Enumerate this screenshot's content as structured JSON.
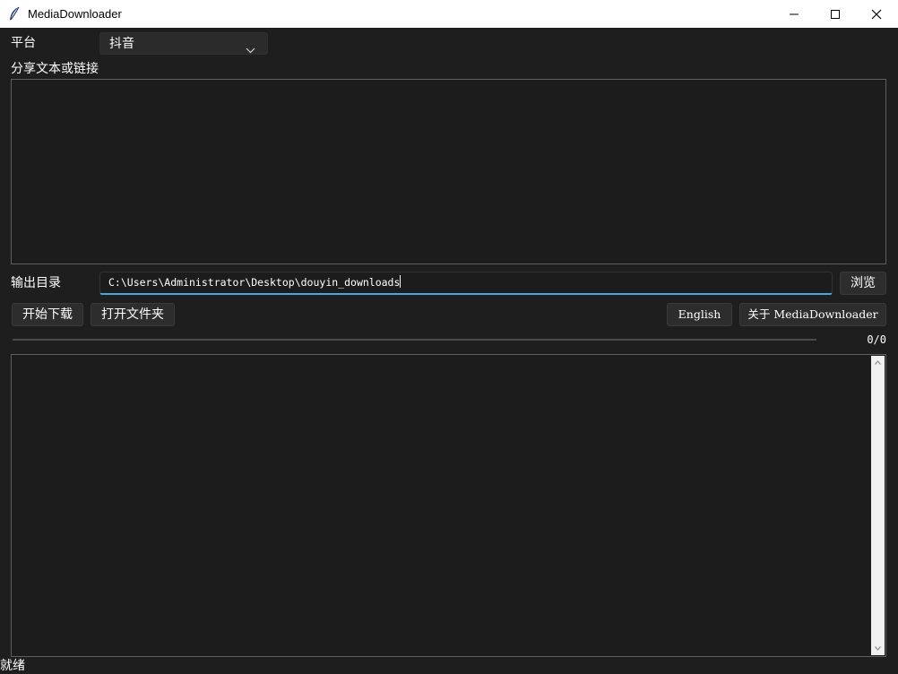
{
  "window": {
    "title": "MediaDownloader",
    "icon": "feather-icon"
  },
  "platform": {
    "label": "平台",
    "selected": "抖音"
  },
  "share": {
    "label": "分享文本或链接",
    "value": ""
  },
  "output": {
    "label": "输出目录",
    "path": "C:\\Users\\Administrator\\Desktop\\douyin_downloads",
    "browse_label": "浏览"
  },
  "actions": {
    "start_label": "开始下载",
    "open_folder_label": "打开文件夹",
    "language_label": "English",
    "about_label": "关于 MediaDownloader"
  },
  "progress": {
    "done": 0,
    "total": 0,
    "text": "0/0"
  },
  "log": {
    "text": ""
  },
  "status": {
    "text": "就绪"
  },
  "colors": {
    "background": "#1e1e1e",
    "accent": "#4ea6dc"
  }
}
